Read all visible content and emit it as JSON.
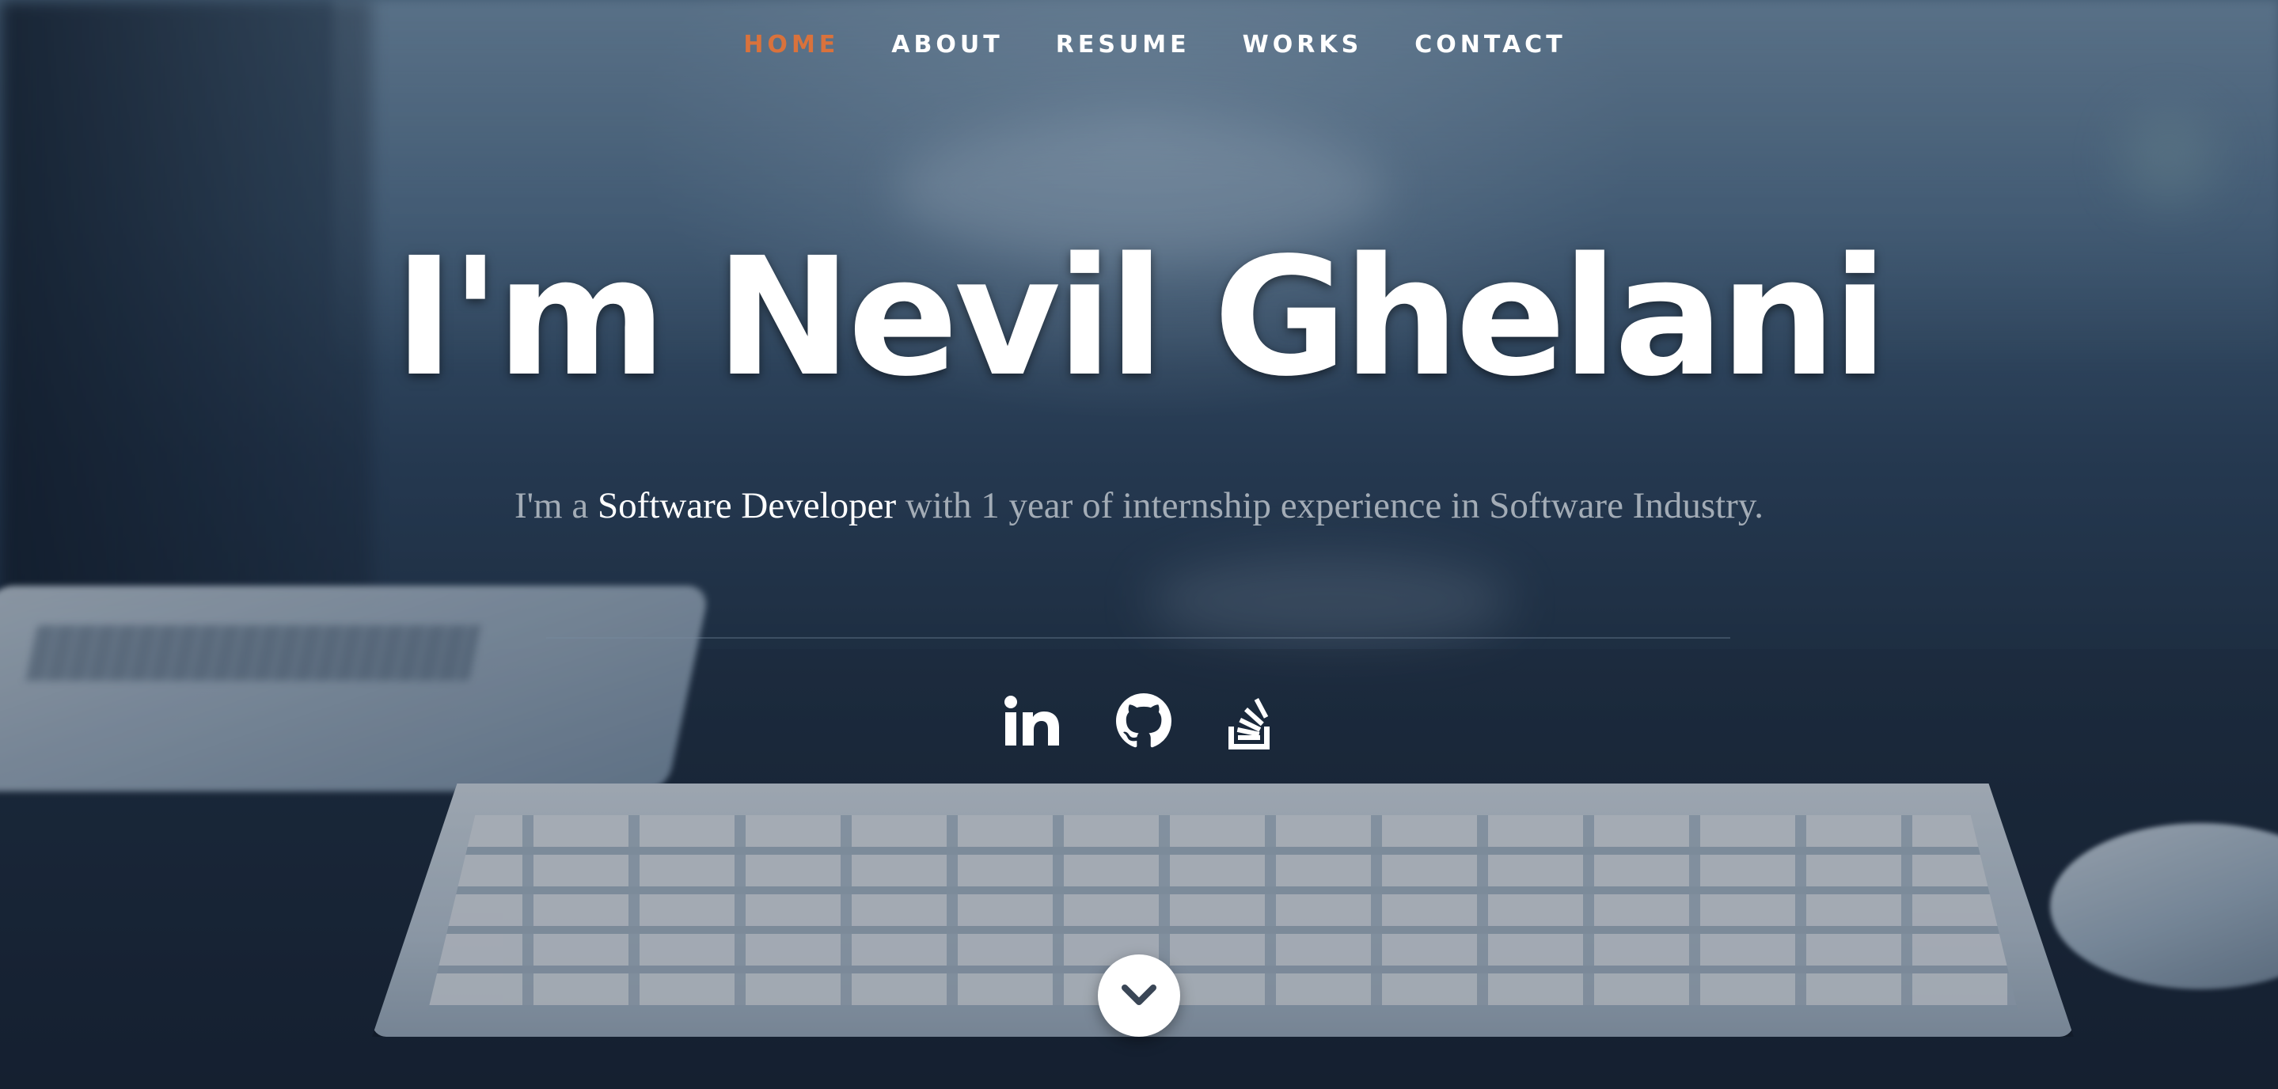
{
  "nav": {
    "items": [
      {
        "label": "HOME",
        "active": true
      },
      {
        "label": "ABOUT",
        "active": false
      },
      {
        "label": "RESUME",
        "active": false
      },
      {
        "label": "WORKS",
        "active": false
      },
      {
        "label": "CONTACT",
        "active": false
      }
    ],
    "active_color": "#d9723c"
  },
  "hero": {
    "title": "I'm Nevil Ghelani",
    "subtitle_prefix": "I'm a ",
    "subtitle_role": "Software Developer",
    "subtitle_suffix": " with 1 year of internship experience in Software Industry."
  },
  "social": [
    {
      "icon": "linkedin-icon"
    },
    {
      "icon": "github-icon"
    },
    {
      "icon": "stackoverflow-icon"
    }
  ],
  "scroll_down": {
    "icon": "chevron-down-icon"
  }
}
